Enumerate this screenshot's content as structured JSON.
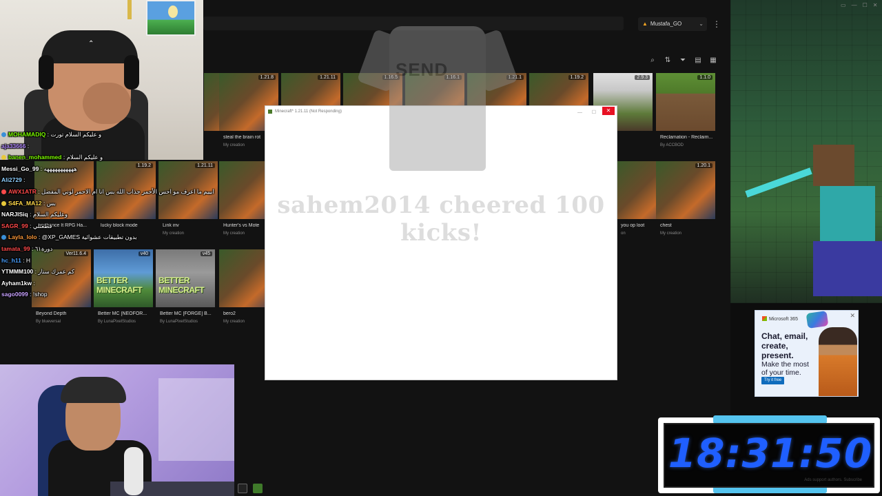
{
  "launcher": {
    "account_name": "Mustafa_GO",
    "toolbar_icons": [
      "search-icon",
      "sort-icon",
      "filter-icon",
      "list-view-icon",
      "grid-view-icon"
    ]
  },
  "tiles": [
    {
      "name": "",
      "sub": "",
      "version": "1.16.1",
      "style": "art"
    },
    {
      "name": "steal the brain rot",
      "sub": "My creation",
      "version": "1.21.8",
      "style": "art"
    },
    {
      "name": "",
      "sub": "",
      "version": "1.21.11",
      "style": "art"
    },
    {
      "name": "",
      "sub": "",
      "version": "1.16.5",
      "style": "art"
    },
    {
      "name": "",
      "sub": "",
      "version": "1.16.1",
      "style": "art"
    },
    {
      "name": "",
      "sub": "",
      "version": "1.21.1",
      "style": "art"
    },
    {
      "name": "",
      "sub": "",
      "version": "1.19.2",
      "style": "art"
    },
    {
      "name": "",
      "sub": "",
      "version": "2.9.3",
      "style": "alc"
    },
    {
      "name": "Reclamation - Reclaim...",
      "sub": "By ACCBOD",
      "version": "1.1.0",
      "style": "grass"
    },
    {
      "name": "enchance It RPG Ha...",
      "sub": "",
      "version": "",
      "style": "art"
    },
    {
      "name": "lucky block mode",
      "sub": "",
      "version": "1.19.2",
      "style": "art"
    },
    {
      "name": "Link inv",
      "sub": "My creation",
      "version": "1.21.11",
      "style": "art"
    },
    {
      "name": "Hunter's vs Mote",
      "sub": "My creation",
      "version": "",
      "style": "art"
    },
    {
      "name": "you op loot",
      "sub": "on",
      "version": "1.18",
      "style": "art"
    },
    {
      "name": "chest",
      "sub": "My creation",
      "version": "1.20.1",
      "style": "art"
    },
    {
      "name": "Beyond Depth",
      "sub": "By blueversal",
      "version": "Ver11.6.4",
      "style": "art"
    },
    {
      "name": "Better MC [NEOFOR...",
      "sub": "By LunaPixelStudios",
      "version": "v40",
      "style": "better",
      "brand": "BETTER MINECRAFT"
    },
    {
      "name": "Better MC [FORGE] B...",
      "sub": "By LunaPixelStudios",
      "version": "v45",
      "style": "better gray",
      "brand": "BETTER MINECRAFT"
    },
    {
      "name": "bero2",
      "sub": "My creation",
      "version": "1.",
      "style": "art"
    }
  ],
  "dialog": {
    "title": "Minecraft* 1.21.11 (Not Responding)",
    "close_label": "✕",
    "min_label": "—",
    "max_label": "☐"
  },
  "alert": {
    "shirt_logo": "SEND",
    "message": "sahem2014 cheered 100 kicks!"
  },
  "chat": {
    "messages": [
      {
        "user": "MOHAMADIQ",
        "text": "و عليكم السلام تورت",
        "color": "#7cfc00",
        "badge": "#3a8fd8"
      },
      {
        "user": "aja33666",
        "text": "",
        "color": "#b48cff",
        "badge": ""
      },
      {
        "user": "banen_mohammed",
        "text": "و عليكم السلام",
        "color": "#7cfc00",
        "badge": "#e8c93a"
      },
      {
        "user": "Messi_Go_99",
        "text": "هههههههههههه",
        "color": "#ffffff",
        "badge": ""
      },
      {
        "user": "Ali2729",
        "text": "",
        "color": "#8fd0ff",
        "badge": ""
      },
      {
        "user": "AWX1ATR",
        "text": "ابييم ما اعرف مو احس الأحمر جذاب الله بس انا ام الاحمر لوني المفضل",
        "color": "#ff4a4a",
        "badge": "#ff4a4a"
      },
      {
        "user": "S4FA_MA12",
        "text": "بس",
        "color": "#ffd84a",
        "badge": "#e8c93a"
      },
      {
        "user": "NARJISiq",
        "text": "وعليكم السلام",
        "color": "#ffffff",
        "badge": ""
      },
      {
        "user": "SAGR_99",
        "text": "قطعتلي",
        "color": "#ff4a4a",
        "badge": ""
      },
      {
        "user": "Layla_lolo",
        "text": "@XP_GAMES بدون تطبيقات عشوائية",
        "color": "#ff9a3a",
        "badge": "#3a8fd8"
      },
      {
        "user": "tamata_99",
        "text": "دورة٦١",
        "color": "#ff4a4a",
        "badge": ""
      },
      {
        "user": "hc_h11",
        "text": "H",
        "color": "#4aa0ff",
        "badge": ""
      },
      {
        "user": "YTMMM100",
        "text": "كم عمرك ستار",
        "color": "#ffffff",
        "badge": ""
      },
      {
        "user": "Ayham1kw",
        "text": "",
        "color": "#ffffff",
        "badge": ""
      },
      {
        "user": "sago0099",
        "text": "!shop",
        "color": "#c8a2ff",
        "badge": ""
      }
    ]
  },
  "ad": {
    "brand": "Microsoft 365",
    "headline": "Chat, email, create, present.",
    "sub": "Make the most of your time.",
    "cta": "Try it free",
    "close_label": "✕"
  },
  "clock": {
    "time": "18:31:50",
    "note": "Ads support authors. Subscribe"
  },
  "colors": {
    "accent_blue": "#1f5fff",
    "clock_tab": "#55c4ef",
    "dialog_close": "#e81123"
  }
}
